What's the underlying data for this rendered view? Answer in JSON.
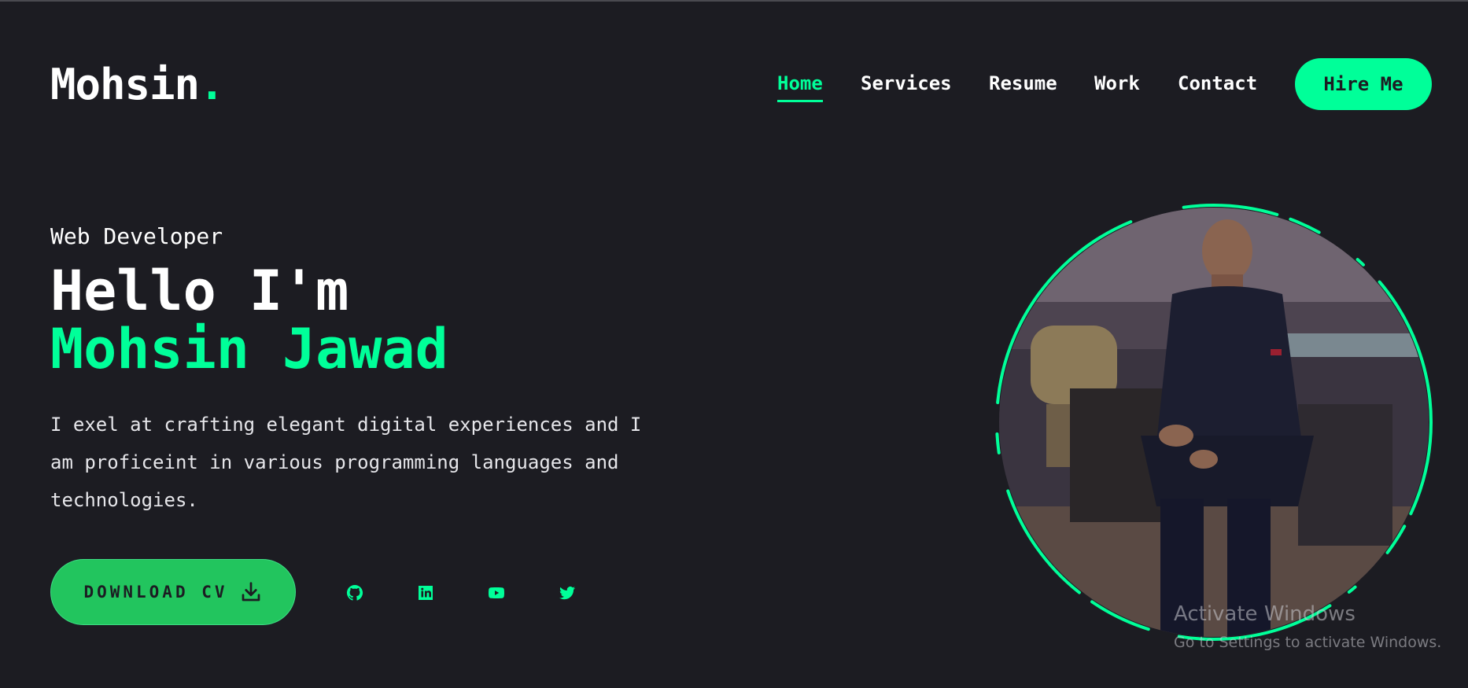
{
  "logo": {
    "text": "Mohsin",
    "dot": "."
  },
  "nav": {
    "items": [
      {
        "label": "Home",
        "active": true
      },
      {
        "label": "Services"
      },
      {
        "label": "Resume"
      },
      {
        "label": "Work"
      },
      {
        "label": "Contact"
      }
    ],
    "hire_label": "Hire Me"
  },
  "hero": {
    "role": "Web Developer",
    "greeting": "Hello I'm",
    "name": "Mohsin Jawad",
    "bio": "I exel at crafting elegant digital experiences and I am proficeint in various programming languages and technologies.",
    "cv_label": "DOWNLOAD CV",
    "social_icons": [
      "github-icon",
      "linkedin-icon",
      "youtube-icon",
      "twitter-icon"
    ]
  },
  "watermark": {
    "title": "Activate Windows",
    "subtitle": "Go to Settings to activate Windows."
  },
  "colors": {
    "background": "#1c1c22",
    "accent": "#00ff99",
    "button": "#22c55e"
  }
}
